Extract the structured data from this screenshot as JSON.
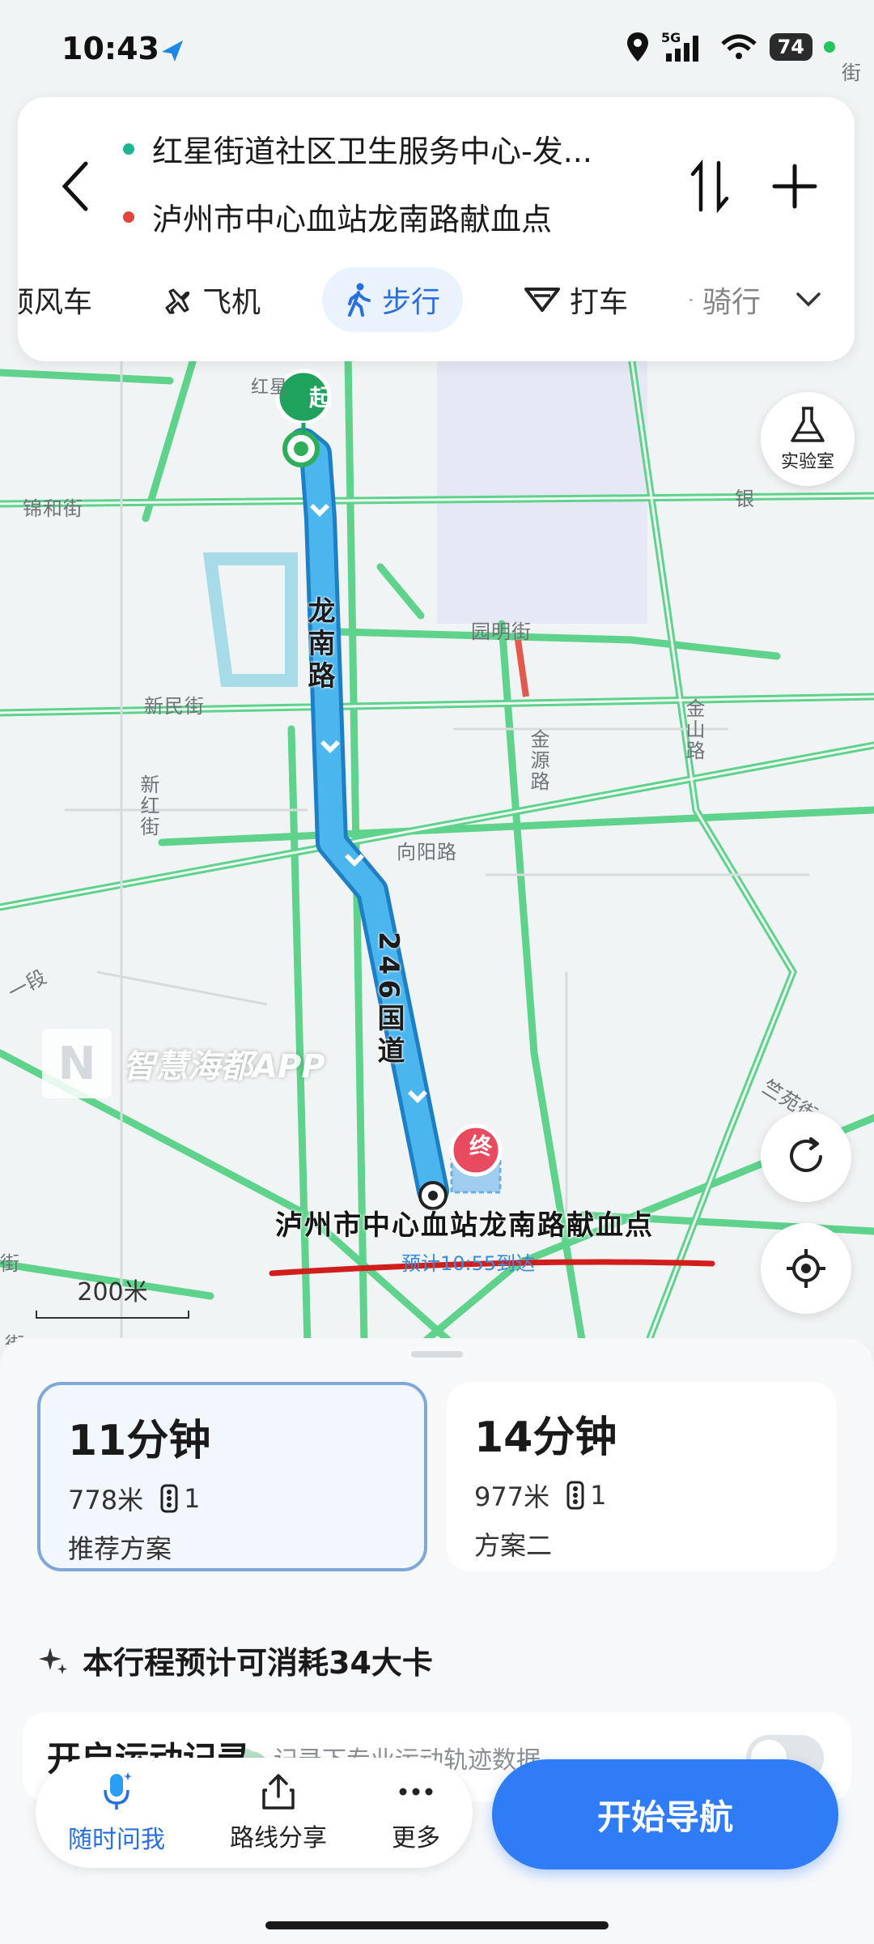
{
  "status_bar": {
    "time": "10:43",
    "network": "5G",
    "battery": "74"
  },
  "route": {
    "origin": "红星街道社区卫生服务中心-发...",
    "destination": "泸州市中心血站龙南路献血点",
    "origin_color": "#1fb58f",
    "destination_color": "#e2453c"
  },
  "modes": [
    {
      "label": "顺风车"
    },
    {
      "label": "飞机"
    },
    {
      "label": "步行"
    },
    {
      "label": "打车"
    },
    {
      "label": "骑行"
    }
  ],
  "map": {
    "start_marker": "起",
    "end_marker": "终",
    "lab_label": "实验室",
    "roads": {
      "jinhe": "锦和街",
      "hongxing": "红星",
      "yuanming": "园明街",
      "xinmin": "新民街",
      "xinhong": "新红街",
      "jinyuan": "金源路",
      "jinshan": "金山路",
      "xiangyang": "向阳路",
      "yin": "银",
      "duan": "一段",
      "jie": "街",
      "jie2": "街",
      "jie3": "街",
      "zhuyuan": "竺苑街"
    },
    "route_road_1": "龙南路",
    "route_road_2": "246国道",
    "destination_label": "泸州市中心血站龙南路献血点",
    "eta": "预计10:55到达",
    "scale": "200米",
    "watermark": "智慧海都APP",
    "watermark_logo": "N",
    "route_color": "#3aa6e6"
  },
  "plans": [
    {
      "time": "11分钟",
      "distance": "778米",
      "lights": "1",
      "tag": "推荐方案",
      "selected": true
    },
    {
      "time": "14分钟",
      "distance": "977米",
      "lights": "1",
      "tag": "方案二",
      "selected": false
    }
  ],
  "calorie": "本行程预计可消耗34大卡",
  "record": {
    "title": "开启运动记录",
    "subtitle": "记录下专业运动轨迹数据"
  },
  "actions": {
    "ask": "随时问我",
    "share": "路线分享",
    "more": "更多",
    "start": "开始导航"
  }
}
